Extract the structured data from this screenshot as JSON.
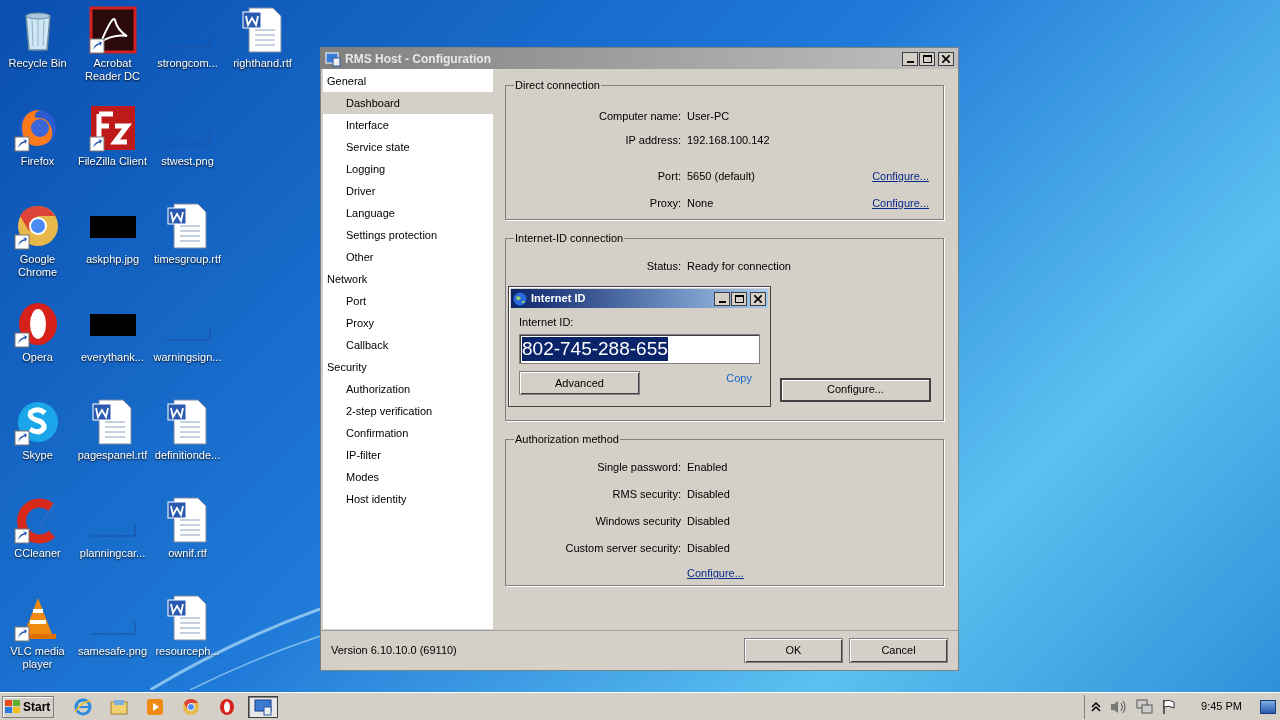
{
  "desktop_icons": [
    [
      {
        "label": "Recycle Bin",
        "kind": "recycle",
        "shortcut": false
      },
      {
        "label": "Firefox",
        "kind": "firefox",
        "shortcut": true
      },
      {
        "label": "Google Chrome",
        "kind": "chrome",
        "shortcut": true
      },
      {
        "label": "Opera",
        "kind": "opera",
        "shortcut": true
      },
      {
        "label": "Skype",
        "kind": "skype",
        "shortcut": true
      },
      {
        "label": "CCleaner",
        "kind": "ccleaner",
        "shortcut": true
      },
      {
        "label": "VLC media player",
        "kind": "vlc",
        "shortcut": true
      }
    ],
    [
      {
        "label": "Acrobat Reader DC",
        "kind": "acrobat",
        "shortcut": true
      },
      {
        "label": "FileZilla Client",
        "kind": "filezilla",
        "shortcut": true
      },
      {
        "label": "askphp.jpg",
        "kind": "dark-image",
        "shortcut": false
      },
      {
        "label": "everythank...",
        "kind": "dark-image",
        "shortcut": false
      },
      {
        "label": "pagespanel.rtf",
        "kind": "document",
        "shortcut": false
      },
      {
        "label": "planningcar...",
        "kind": "blank-image",
        "shortcut": false
      },
      {
        "label": "samesafe.png",
        "kind": "blank-image",
        "shortcut": false
      }
    ],
    [
      {
        "label": "strongcom...",
        "kind": "blank-image",
        "shortcut": false
      },
      {
        "label": "stwest.png",
        "kind": "blank-image",
        "shortcut": false
      },
      {
        "label": "timesgroup.rtf",
        "kind": "document",
        "shortcut": false
      },
      {
        "label": "warningsign...",
        "kind": "blank-image",
        "shortcut": false
      },
      {
        "label": "definitionde...",
        "kind": "document",
        "shortcut": false
      },
      {
        "label": "ownif.rtf",
        "kind": "document",
        "shortcut": false
      },
      {
        "label": "resourceph...",
        "kind": "document",
        "shortcut": false
      }
    ],
    [
      {
        "label": "righthand.rtf",
        "kind": "document",
        "shortcut": false
      }
    ]
  ],
  "window": {
    "title": "RMS Host - Configuration",
    "sidebar": [
      {
        "label": "General",
        "selected": false,
        "children": [
          {
            "label": "Dashboard",
            "selected": true
          },
          {
            "label": "Interface",
            "selected": false
          },
          {
            "label": "Service state",
            "selected": false
          },
          {
            "label": "Logging",
            "selected": false
          },
          {
            "label": "Driver",
            "selected": false
          },
          {
            "label": "Language",
            "selected": false
          },
          {
            "label": "Settings protection",
            "selected": false
          },
          {
            "label": "Other",
            "selected": false
          }
        ]
      },
      {
        "label": "Network",
        "selected": false,
        "children": [
          {
            "label": "Port",
            "selected": false
          },
          {
            "label": "Proxy",
            "selected": false
          },
          {
            "label": "Callback",
            "selected": false
          }
        ]
      },
      {
        "label": "Security",
        "selected": false,
        "children": [
          {
            "label": "Authorization",
            "selected": false
          },
          {
            "label": "2-step verification",
            "selected": false
          },
          {
            "label": "Confirmation",
            "selected": false
          },
          {
            "label": "IP-filter",
            "selected": false
          },
          {
            "label": "Modes",
            "selected": false
          },
          {
            "label": "Host identity",
            "selected": false
          }
        ]
      }
    ],
    "direct_connection": {
      "title": "Direct connection",
      "rows": [
        {
          "label": "Computer name:",
          "value": "User-PC"
        },
        {
          "label": "IP address:",
          "value": "192.168.100.142"
        },
        {
          "label": "Port:",
          "value": "5650 (default)",
          "link": "Configure..."
        },
        {
          "label": "Proxy:",
          "value": "None",
          "link": "Configure..."
        }
      ]
    },
    "internet_id_connection": {
      "title": "Internet-ID connection",
      "status_label": "Status:",
      "status_value": "Ready for connection",
      "button": "Configure..."
    },
    "authorization_method": {
      "title": "Authorization method",
      "rows": [
        {
          "label": "Single password:",
          "value": "Enabled"
        },
        {
          "label": "RMS security:",
          "value": "Disabled"
        },
        {
          "label": "Windows security",
          "value": "Disabled"
        },
        {
          "label": "Custom server security:",
          "value": "Disabled"
        }
      ],
      "link": "Configure..."
    },
    "version": "Version 6.10.10.0 (69110)",
    "buttons": [
      "OK",
      "Cancel"
    ]
  },
  "internet_id_dialog": {
    "title": "Internet ID",
    "label": "Internet ID:",
    "value": "802-745-288-655",
    "text_selected": true,
    "button": "Advanced",
    "link": "Copy"
  },
  "taskbar": {
    "start": "Start",
    "apps": [
      {
        "kind": "ie",
        "active": false
      },
      {
        "kind": "explorer",
        "active": false
      },
      {
        "kind": "media",
        "active": false
      },
      {
        "kind": "chrome",
        "active": false
      },
      {
        "kind": "opera",
        "active": false
      },
      {
        "kind": "rms",
        "active": true
      }
    ],
    "clock": "9:45 PM"
  }
}
